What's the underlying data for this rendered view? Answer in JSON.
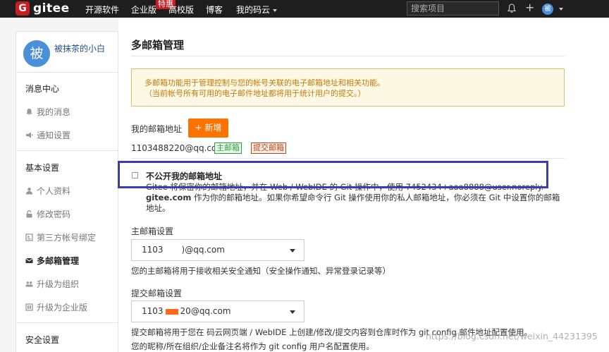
{
  "topbar": {
    "logo_letter": "G",
    "logo_text": "gitee",
    "nav": {
      "open_source": "开源软件",
      "enterprise": "企业版",
      "enterprise_badge": "特惠",
      "university": "高校版",
      "blog": "博客",
      "my_code_cloud": "我的码云"
    },
    "search_placeholder": "搜索项目",
    "avatar_letter": "被"
  },
  "sidebar": {
    "avatar_letter": "被",
    "username": "被抹茶的小白",
    "sections": {
      "messages": "消息中心",
      "basic": "基本设置",
      "security": "安全设置"
    },
    "items": {
      "my_messages": "我的消息",
      "notify_settings": "通知设置",
      "profile": "个人资料",
      "password": "修改密码",
      "third_party": "第三方帐号绑定",
      "multi_email": "多邮箱管理",
      "to_org": "升级为组织",
      "to_enterprise": "升级为企业版"
    }
  },
  "main": {
    "title": "多邮箱管理",
    "notice_line1": "多邮箱功能用于管理控制与您的帐号关联的电子邮箱地址和相关功能。",
    "notice_line2": "（当前帐号所有可用的电子邮件地址都将用于统计用户的提交。）",
    "my_email_label": "我的邮箱地址",
    "add_button": "+ 新增",
    "email": "1103488220@qq.com",
    "tag_primary": "主邮箱",
    "tag_commit": "提交邮箱",
    "private_label": "不公开我的邮箱地址",
    "private_desc_line1": "Gitee 将保密你的邮箱地址，并在 Web / WebIDE 的 Git 操作中，使用 7452434+aaa8888@user.noreply.",
    "private_desc_domain": "gitee.com",
    "private_desc_line2": " 作为你的邮箱地址。如果你希望命令行 Git 操作使用你的私人邮箱地址，你必须在 Git 中设置你的邮箱",
    "private_desc_line3": "地址。",
    "primary_setting_label": "主邮箱设置",
    "primary_select_prefix": "1103",
    "primary_select_suffix": ")@qq.com",
    "primary_help": "您的主邮箱将用于接收相关安全通知（安全操作通知、异常登录记录等）",
    "commit_setting_label": "提交邮箱设置",
    "commit_select_prefix": "1103",
    "commit_select_suffix": "20@qq.com",
    "commit_help1": "提交邮箱将用于您在 码云网页端 / WebIDE 上创建/修改/提交内容到仓库时作为 git config 邮件地址配置使用。",
    "commit_help2": "您的昵称/所在组织/企业备注名将作为 git config 用户名配置使用。"
  },
  "watermark": "https://blog.csdn.net/weixin_44231395",
  "colors": {
    "accent": "#fe7300",
    "brand": "#c71d23",
    "highlight_box": "#3a3cb5"
  }
}
